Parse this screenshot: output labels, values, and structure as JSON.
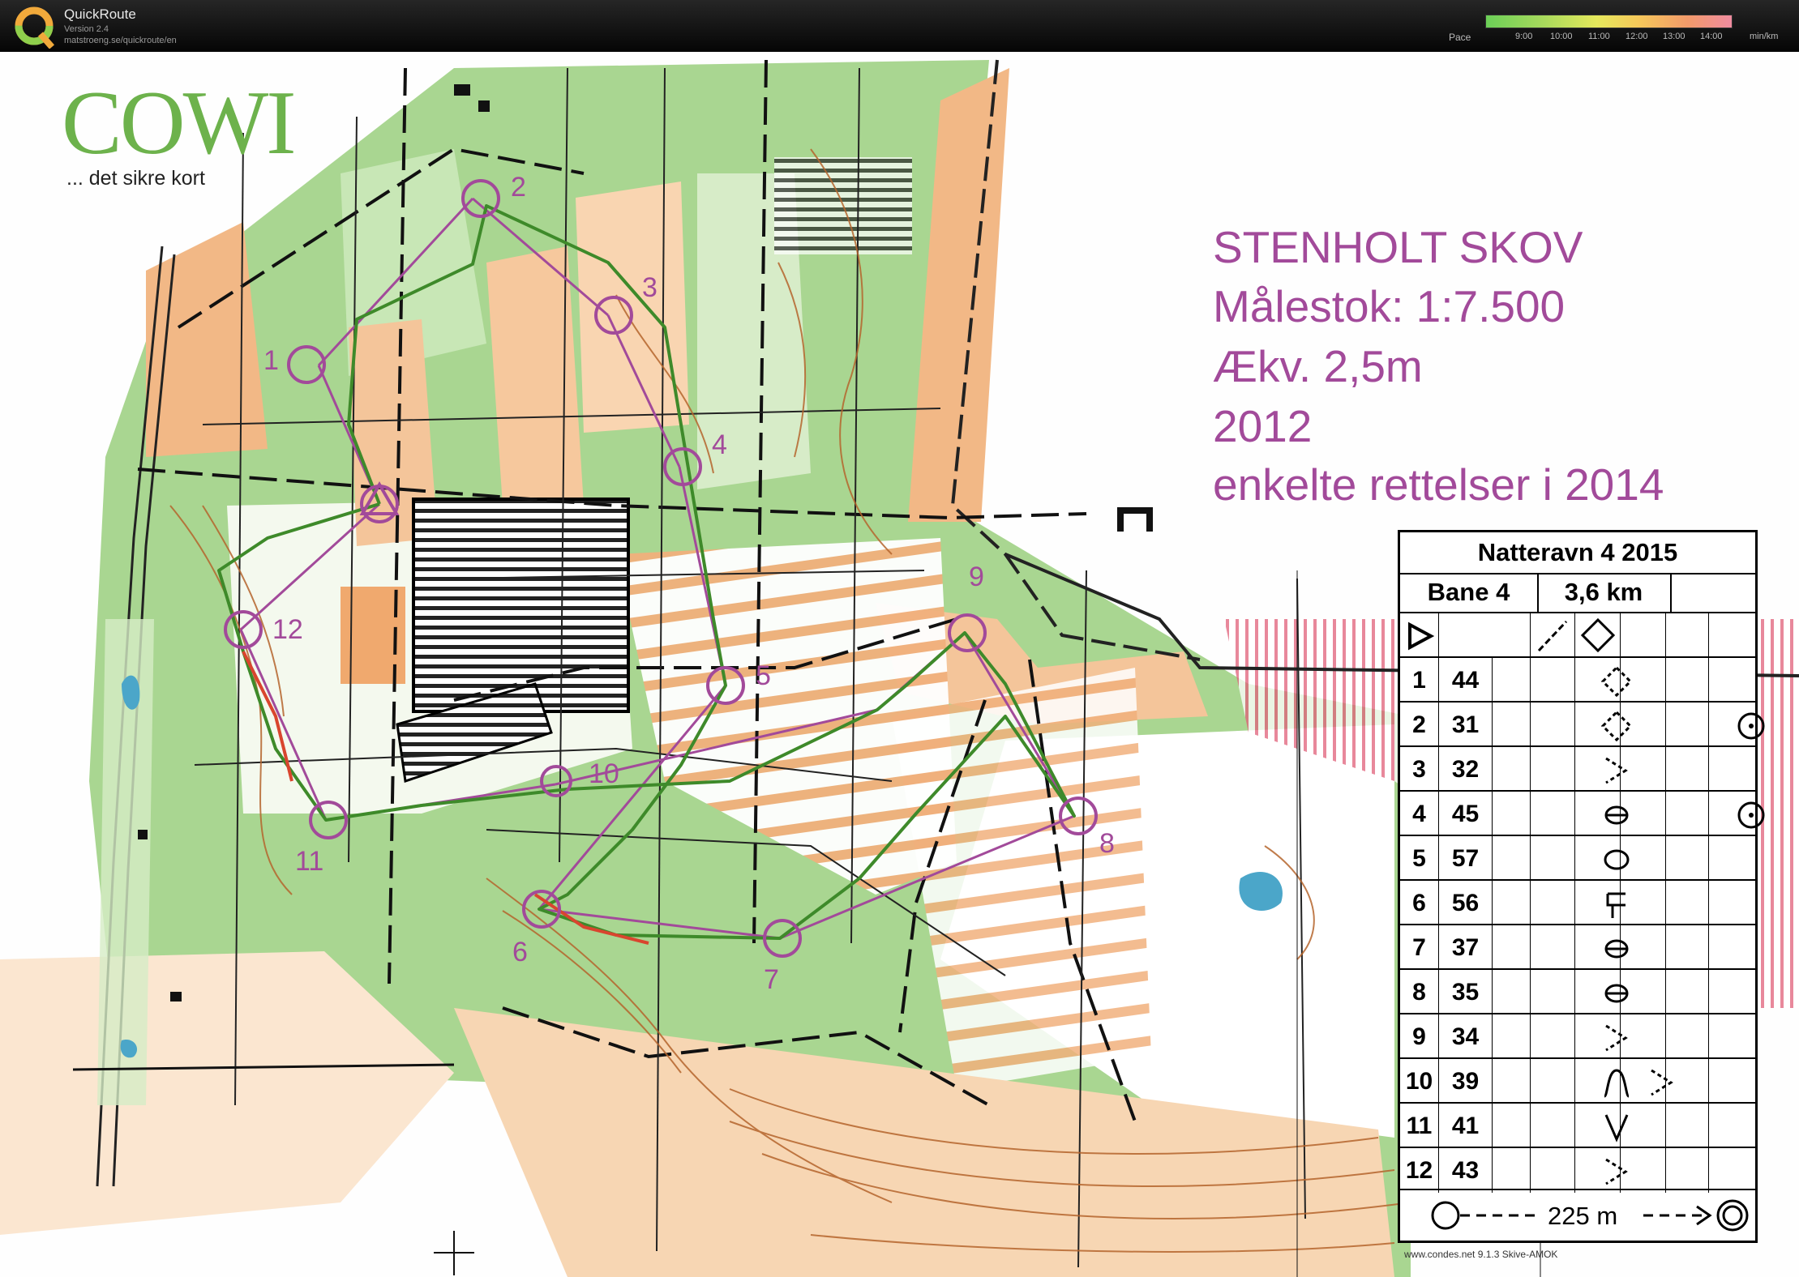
{
  "app": {
    "name": "QuickRoute",
    "version": "Version 2.4",
    "url": "matstroeng.se/quickroute/en",
    "logo_letter": "Q"
  },
  "pace_legend": {
    "label": "Pace",
    "ticks": [
      "9:00",
      "10:00",
      "11:00",
      "12:00",
      "13:00",
      "14:00"
    ],
    "unit": "min/km"
  },
  "map": {
    "publisher": "COWI",
    "tagline": "... det sikre kort",
    "title": "STENHOLT SKOV",
    "scale": "Målestok: 1:7.500",
    "contour": "Ækv. 2,5m",
    "year": "2012",
    "revision": "enkelte rettelser i 2014",
    "colors": {
      "course": "#a24a9a",
      "route": "#3e8a2a",
      "forest": "#9fd087",
      "open": "#f4c28c",
      "brand": "#6db24c"
    }
  },
  "control_labels": [
    "1",
    "2",
    "3",
    "4",
    "5",
    "6",
    "7",
    "8",
    "9",
    "10",
    "11",
    "12"
  ],
  "control_description": {
    "event": "Natteravn 4 2015",
    "course": "Bane 4",
    "length": "3,6 km",
    "rows": [
      {
        "n": "1",
        "code": "44",
        "symbols": [
          "vegetation-boundary-icon"
        ]
      },
      {
        "n": "2",
        "code": "31",
        "symbols": [
          "vegetation-boundary-icon",
          "tree-icon"
        ]
      },
      {
        "n": "3",
        "code": "32",
        "symbols": [
          "corner-icon"
        ]
      },
      {
        "n": "4",
        "code": "45",
        "symbols": [
          "bush-icon",
          "tree-icon"
        ]
      },
      {
        "n": "5",
        "code": "57",
        "symbols": [
          "thicket-icon"
        ]
      },
      {
        "n": "6",
        "code": "56",
        "symbols": [
          "path-junction-icon"
        ]
      },
      {
        "n": "7",
        "code": "37",
        "symbols": [
          "bush-icon"
        ]
      },
      {
        "n": "8",
        "code": "35",
        "symbols": [
          "bush-icon"
        ]
      },
      {
        "n": "9",
        "code": "34",
        "symbols": [
          "corner-icon"
        ]
      },
      {
        "n": "10",
        "code": "39",
        "symbols": [
          "knoll-icon",
          "corner-icon"
        ]
      },
      {
        "n": "11",
        "code": "41",
        "symbols": [
          "gully-icon"
        ]
      },
      {
        "n": "12",
        "code": "43",
        "symbols": [
          "corner-icon"
        ]
      }
    ],
    "finish_distance": "225 m"
  },
  "imprint": "www.condes.net 9.1.3 Skive-AMOK"
}
